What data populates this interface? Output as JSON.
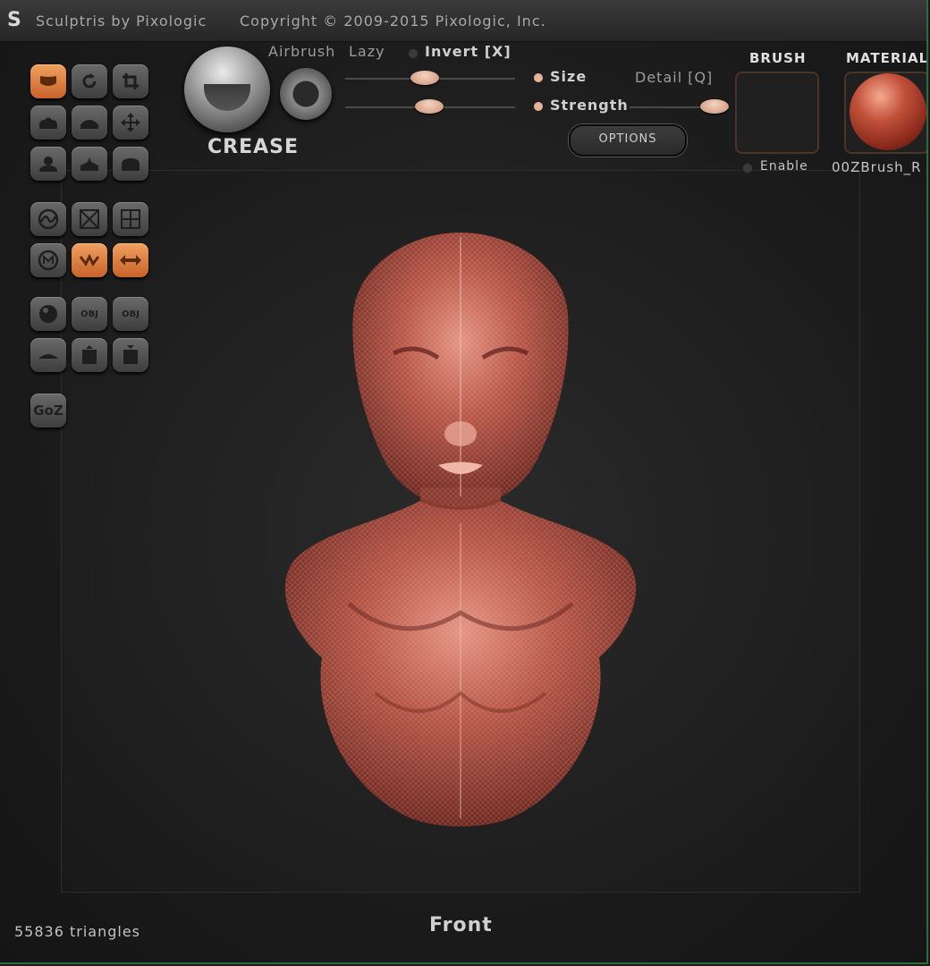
{
  "app": {
    "title": "Sculptris by Pixologic",
    "copyright": "Copyright © 2009-2015 Pixologic, Inc.",
    "logo_icon": "sculptris-s-logo-icon"
  },
  "brush": {
    "name": "CREASE",
    "airbrush_label": "Airbrush",
    "lazy_label": "Lazy",
    "invert_label": "Invert [X]",
    "size_label": "Size",
    "strength_label": "Strength",
    "detail_label": "Detail [Q]",
    "options_label": "OPTIONS",
    "size_value": 0.45,
    "strength_value": 0.5,
    "detail_value": 0.85
  },
  "brush_panel": {
    "title": "BRUSH",
    "enable_label": "Enable"
  },
  "material_panel": {
    "title": "MATERIAL",
    "name": "00ZBrush_R",
    "color": "#c0503a"
  },
  "toolbar": {
    "groups": [
      [
        "draw-tool-icon",
        "rotate-tool-icon",
        "crop-tool-icon",
        "inflate-tool-icon",
        "pinch-tool-icon",
        "move-tool-icon",
        "flatten-tool-icon",
        "layer-tool-icon",
        "smooth-tool-icon"
      ],
      [
        "symmetry-icon",
        "wireframe-icon",
        "grid-icon",
        "material-icon",
        "crease-active-icon",
        "mirror-icon"
      ],
      [
        "sphere-icon",
        "import-obj-icon",
        "export-obj-icon",
        "plane-icon",
        "open-file-icon",
        "save-file-icon"
      ],
      [
        "goz-icon"
      ]
    ],
    "obj_label": "OBJ",
    "goz_label": "GoZ"
  },
  "status": {
    "triangles": "55836 triangles",
    "view": "Front"
  },
  "colors": {
    "accent": "#d9733a",
    "model": "#b9584a",
    "window_border": "#2f6b3a"
  }
}
